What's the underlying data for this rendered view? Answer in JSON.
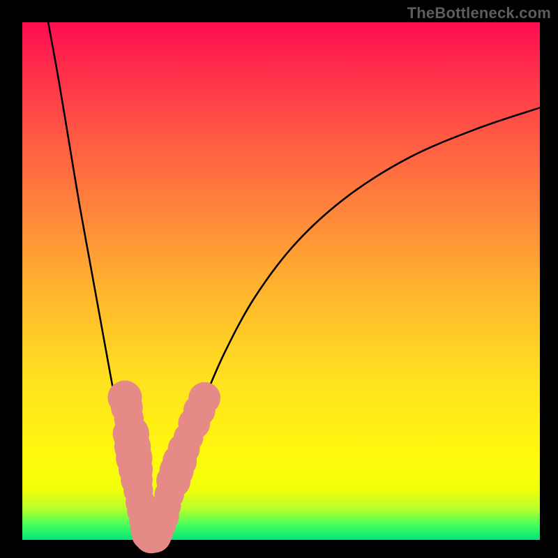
{
  "watermark": "TheBottleneck.com",
  "chart_data": {
    "type": "line",
    "title": "",
    "xlabel": "",
    "ylabel": "",
    "xlim": [
      0,
      100
    ],
    "ylim": [
      0,
      100
    ],
    "background_gradient": [
      "#ff0d52",
      "#ff8a3a",
      "#ffe31f",
      "#00e57a"
    ],
    "series": [
      {
        "name": "left-curve",
        "stroke": "#000000",
        "x": [
          5,
          7,
          9,
          11,
          13,
          15,
          17,
          18.5,
          20,
          21,
          22,
          22.8,
          23.4,
          23.8,
          24.2
        ],
        "y": [
          100,
          89,
          77,
          65,
          54,
          43,
          32,
          24,
          16,
          11,
          7,
          4,
          2.2,
          1.2,
          0.6
        ]
      },
      {
        "name": "right-curve",
        "stroke": "#000000",
        "x": [
          25.4,
          25.8,
          26.4,
          27.2,
          28.2,
          29.5,
          31.5,
          34.5,
          39,
          45,
          53,
          63,
          75,
          88,
          100
        ],
        "y": [
          0.6,
          1.2,
          2.4,
          4.5,
          7.5,
          11.5,
          17.5,
          25.5,
          36,
          47,
          57.5,
          66.5,
          74,
          79.5,
          83.5
        ]
      }
    ],
    "scatter": {
      "name": "highlight-dots",
      "fill": "#e58a86",
      "points": [
        {
          "x": 19.8,
          "y": 27.5,
          "r": 3.0
        },
        {
          "x": 20.2,
          "y": 25.6,
          "r": 2.8
        },
        {
          "x": 20.6,
          "y": 23.4,
          "r": 2.6
        },
        {
          "x": 21.0,
          "y": 20.5,
          "r": 3.2
        },
        {
          "x": 21.3,
          "y": 18.0,
          "r": 3.2
        },
        {
          "x": 21.6,
          "y": 15.8,
          "r": 3.2
        },
        {
          "x": 21.9,
          "y": 13.6,
          "r": 3.0
        },
        {
          "x": 22.1,
          "y": 11.6,
          "r": 2.8
        },
        {
          "x": 22.4,
          "y": 9.6,
          "r": 2.6
        },
        {
          "x": 22.8,
          "y": 7.2,
          "r": 2.6
        },
        {
          "x": 23.1,
          "y": 5.6,
          "r": 2.6
        },
        {
          "x": 23.5,
          "y": 3.8,
          "r": 2.6
        },
        {
          "x": 23.9,
          "y": 2.4,
          "r": 2.8
        },
        {
          "x": 24.4,
          "y": 1.2,
          "r": 3.0
        },
        {
          "x": 24.9,
          "y": 0.7,
          "r": 3.0
        },
        {
          "x": 25.5,
          "y": 0.8,
          "r": 3.0
        },
        {
          "x": 26.1,
          "y": 1.6,
          "r": 2.8
        },
        {
          "x": 26.6,
          "y": 2.9,
          "r": 2.8
        },
        {
          "x": 27.2,
          "y": 4.6,
          "r": 2.8
        },
        {
          "x": 27.8,
          "y": 6.6,
          "r": 2.6
        },
        {
          "x": 28.4,
          "y": 8.8,
          "r": 2.6
        },
        {
          "x": 29.2,
          "y": 11.4,
          "r": 3.0
        },
        {
          "x": 29.8,
          "y": 13.4,
          "r": 3.0
        },
        {
          "x": 30.4,
          "y": 15.2,
          "r": 3.0
        },
        {
          "x": 31.2,
          "y": 17.6,
          "r": 2.8
        },
        {
          "x": 32.1,
          "y": 19.8,
          "r": 2.6
        },
        {
          "x": 33.2,
          "y": 22.5,
          "r": 2.8
        },
        {
          "x": 34.2,
          "y": 25.0,
          "r": 2.8
        },
        {
          "x": 35.2,
          "y": 27.4,
          "r": 2.8
        }
      ]
    }
  }
}
